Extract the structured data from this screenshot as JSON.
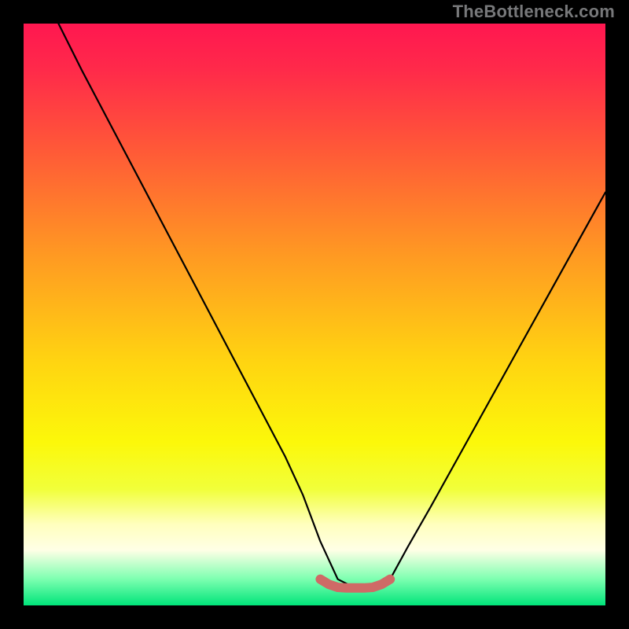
{
  "watermark": "TheBottleneck.com",
  "colors": {
    "background": "#000000",
    "curve": "#000000",
    "highlight": "#cf6a66",
    "gradient_stops": [
      {
        "offset": 0.0,
        "color": "#ff1750"
      },
      {
        "offset": 0.08,
        "color": "#ff2a4a"
      },
      {
        "offset": 0.22,
        "color": "#ff5a37"
      },
      {
        "offset": 0.4,
        "color": "#ff9a22"
      },
      {
        "offset": 0.58,
        "color": "#ffd411"
      },
      {
        "offset": 0.72,
        "color": "#fcf80a"
      },
      {
        "offset": 0.8,
        "color": "#f1ff3a"
      },
      {
        "offset": 0.86,
        "color": "#ffffbd"
      },
      {
        "offset": 0.905,
        "color": "#ffffe6"
      },
      {
        "offset": 0.955,
        "color": "#7cffb0"
      },
      {
        "offset": 1.0,
        "color": "#00e47a"
      }
    ]
  },
  "chart_data": {
    "type": "line",
    "title": "",
    "xlabel": "",
    "ylabel": "",
    "xlim": [
      0,
      100
    ],
    "ylim": [
      0,
      100
    ],
    "grid": false,
    "legend": "none",
    "series": [
      {
        "name": "bottleneck-curve",
        "x": [
          6,
          10,
          15,
          20,
          25,
          30,
          35,
          40,
          45,
          48,
          51,
          54,
          57,
          60,
          63,
          66,
          70,
          75,
          80,
          85,
          90,
          95,
          100
        ],
        "y": [
          100,
          92,
          82.5,
          73,
          63.5,
          54,
          44.5,
          35,
          25.5,
          19,
          11,
          4.5,
          3,
          3,
          4.5,
          10,
          17,
          26,
          35,
          44,
          53,
          62,
          71
        ]
      }
    ],
    "highlight": {
      "name": "optimal-range",
      "x": [
        51,
        52.5,
        54,
        55.5,
        57,
        58.5,
        60,
        61.5,
        63
      ],
      "y": [
        4.5,
        3.6,
        3.1,
        3.0,
        3.0,
        3.0,
        3.1,
        3.6,
        4.5
      ]
    }
  }
}
